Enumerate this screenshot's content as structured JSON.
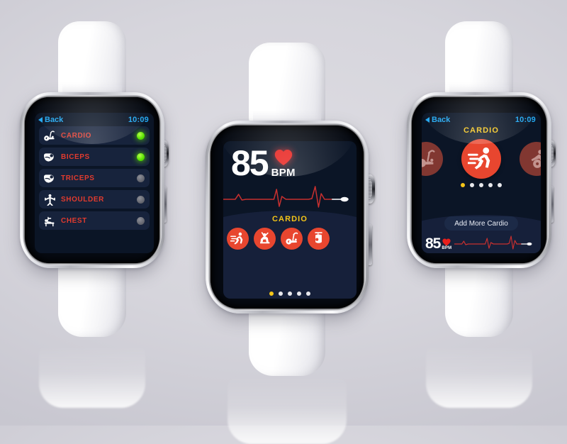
{
  "scene": {
    "title": "Apple Watch fitness app UI mockup — three watches",
    "background_top": "#d9d8de",
    "background_edge": "#c5c4ce",
    "band_color": "#ffffff",
    "case_color": "#c9cad0"
  },
  "theme": {
    "screen_bg": "#0b1526",
    "row_bg": "#17233c",
    "arc_bg": "#16203a",
    "accent_red": "#e8462f",
    "label_red": "#e23b2e",
    "accent_yellow": "#f5c518",
    "link_blue": "#22a7f0",
    "toggle_on": "#55e000",
    "toggle_off": "#63656e",
    "ecg_red": "#c8302f",
    "text_white": "#ffffff"
  },
  "watch_list": {
    "name": "workout-list-screen",
    "statusbar": {
      "back_label": "Back",
      "time": "10:09"
    },
    "items": [
      {
        "label": "CARDIO",
        "icon": "exercise-bike-icon",
        "toggle": "on"
      },
      {
        "label": "BICEPS",
        "icon": "flexed-bicep-icon",
        "toggle": "on"
      },
      {
        "label": "TRICEPS",
        "icon": "flexed-bicep-icon",
        "toggle": "off"
      },
      {
        "label": "SHOULDER",
        "icon": "shoulder-press-icon",
        "toggle": "off"
      },
      {
        "label": "CHEST",
        "icon": "bench-press-icon",
        "toggle": "off"
      }
    ]
  },
  "watch_bpm": {
    "name": "heart-rate-screen",
    "value": "85",
    "unit": "BPM",
    "heart_icon": "heart-icon",
    "ecg_icon": "ecg-waveform-icon",
    "section_label": "CARDIO",
    "shortcuts": [
      {
        "icon": "running-icon",
        "label": "Running"
      },
      {
        "icon": "sit-up-icon",
        "label": "Sit-ups"
      },
      {
        "icon": "exercise-bike-icon",
        "label": "Exercise bike"
      },
      {
        "icon": "punching-bag-icon",
        "label": "Punching bag"
      }
    ],
    "pager": {
      "count": 5,
      "active_index": 0
    }
  },
  "watch_carousel": {
    "name": "cardio-carousel-screen",
    "statusbar": {
      "back_label": "Back",
      "time": "10:09"
    },
    "title": "CARDIO",
    "carousel": {
      "left_icon": "exercise-bike-icon",
      "center_icon": "running-icon",
      "right_icon": "spin-bike-icon"
    },
    "pager": {
      "count": 5,
      "active_index": 0
    },
    "add_button_label": "Add More Cardio",
    "bpm": {
      "value": "85",
      "unit": "BPM",
      "heart_icon": "heart-icon",
      "ecg_icon": "ecg-waveform-icon"
    }
  }
}
